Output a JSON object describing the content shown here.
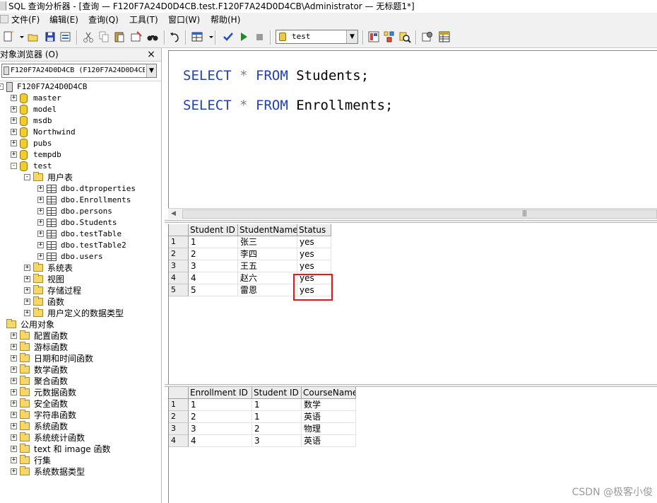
{
  "window": {
    "title": "SQL 查询分析器 - [查询 — F120F7A24D0D4CB.test.F120F7A24D0D4CB\\Administrator — 无标题1*]"
  },
  "menu": {
    "items": [
      {
        "label": "文件(F)"
      },
      {
        "label": "编辑(E)"
      },
      {
        "label": "查询(Q)"
      },
      {
        "label": "工具(T)"
      },
      {
        "label": "窗口(W)"
      },
      {
        "label": "帮助(H)"
      }
    ]
  },
  "toolbar": {
    "database_selected": "test",
    "icons": [
      "new-query-icon",
      "open-icon",
      "save-icon",
      "insert-template-icon",
      "cut-icon",
      "copy-icon",
      "paste-icon",
      "clear-icon",
      "find-icon",
      "undo-icon",
      "results-grid-icon",
      "parse-icon",
      "execute-icon",
      "cancel-icon",
      "object-browser-icon",
      "object-search-icon",
      "display-plan-icon",
      "properties-icon",
      "grid-icon"
    ],
    "colors": {
      "execute": "#1a8f1a",
      "parse": "#1f4fbf"
    }
  },
  "object_browser": {
    "title": "对象浏览器 (O)",
    "close_label": "×",
    "server_combo": "F120F7A24D0D4CB (F120F7A24D0D4CB\\",
    "server_node": "F120F7A24D0D4CB",
    "databases": [
      "master",
      "model",
      "msdb",
      "Northwind",
      "pubs",
      "tempdb",
      "test"
    ],
    "test_children": {
      "user_tables_label": "用户表",
      "tables": [
        "dbo.dtproperties",
        "dbo.Enrollments",
        "dbo.persons",
        "dbo.Students",
        "dbo.testTable",
        "dbo.testTable2",
        "dbo.users"
      ],
      "other_folders": [
        "系统表",
        "视图",
        "存储过程",
        "函数",
        "用户定义的数据类型"
      ]
    },
    "common_objects_label": "公用对象",
    "common_objects": [
      "配置函数",
      "游标函数",
      "日期和时间函数",
      "数学函数",
      "聚合函数",
      "元数据函数",
      "安全函数",
      "字符串函数",
      "系统函数",
      "系统统计函数",
      "text 和 image 函数",
      "行集",
      "系统数据类型"
    ]
  },
  "editor": {
    "line1": {
      "keyword1": "SELECT",
      "star": "*",
      "keyword2": "FROM",
      "table": "Students;"
    },
    "line2": {
      "keyword1": "SELECT",
      "star": "*",
      "keyword2": "FROM",
      "table": "Enrollments;"
    }
  },
  "results1": {
    "columns": [
      "Student ID",
      "StudentName",
      "Status"
    ],
    "rows": [
      {
        "num": "1",
        "cells": [
          "1",
          "张三",
          "yes"
        ]
      },
      {
        "num": "2",
        "cells": [
          "2",
          "李四",
          "yes"
        ]
      },
      {
        "num": "3",
        "cells": [
          "3",
          "王五",
          "yes"
        ]
      },
      {
        "num": "4",
        "cells": [
          "4",
          "赵六",
          "yes"
        ]
      },
      {
        "num": "5",
        "cells": [
          "5",
          "雷恩",
          "yes"
        ]
      }
    ]
  },
  "results2": {
    "columns": [
      "Enrollment ID",
      "Student ID",
      "CourseName"
    ],
    "rows": [
      {
        "num": "1",
        "cells": [
          "1",
          "1",
          "数学"
        ]
      },
      {
        "num": "2",
        "cells": [
          "2",
          "1",
          "英语"
        ]
      },
      {
        "num": "3",
        "cells": [
          "3",
          "2",
          "物理"
        ]
      },
      {
        "num": "4",
        "cells": [
          "4",
          "3",
          "英语"
        ]
      }
    ]
  },
  "highlight_color": "#e01b1b",
  "watermark": "CSDN @极客小俊"
}
